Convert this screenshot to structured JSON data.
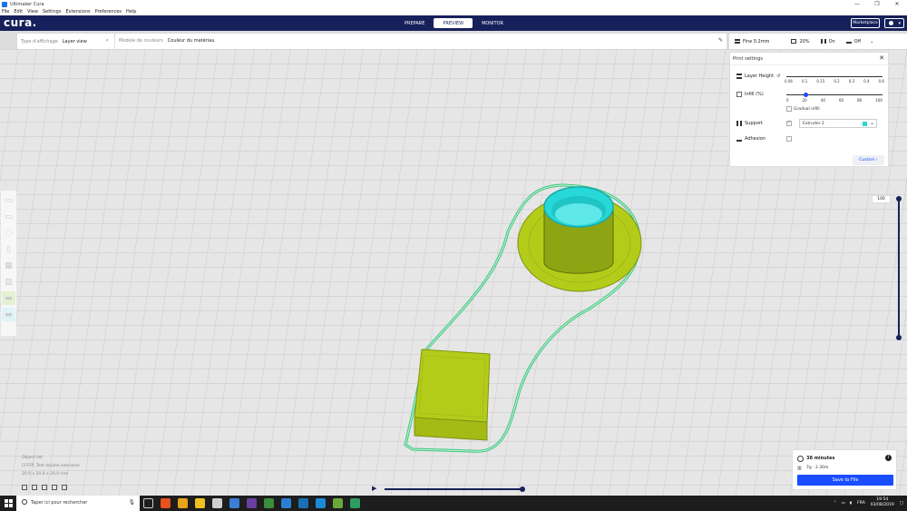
{
  "window": {
    "title": "Ultimaker Cura",
    "controls": [
      "—",
      "❐",
      "✕"
    ]
  },
  "menu": [
    "File",
    "Edit",
    "View",
    "Settings",
    "Extensions",
    "Preferences",
    "Help"
  ],
  "header": {
    "logo": "cura.",
    "stages": [
      "PREPARE",
      "PREVIEW",
      "MONITOR"
    ],
    "active_stage": "PREVIEW",
    "marketplace": "Marketplace"
  },
  "viewbar": {
    "view_type_label": "Type d'affichage",
    "view_type_value": "Layer view",
    "color_label": "Modèle de couleurs",
    "color_value": "Couleur du matériau"
  },
  "printbar": {
    "profile": "Fine 0.2mm",
    "infill": "20%",
    "support": "On",
    "adhesion": "Off"
  },
  "print_settings": {
    "title": "Print settings",
    "layer_height": {
      "label": "Layer Height",
      "ticks": [
        "0.06",
        "0.1",
        "0.15",
        "0.2",
        "0.3",
        "0.4",
        "0.6"
      ]
    },
    "infill": {
      "label": "Infill (%)",
      "ticks": [
        "0",
        "20",
        "40",
        "60",
        "80",
        "100"
      ],
      "value_fraction": 0.2,
      "gradual_label": "Gradual infill"
    },
    "support": {
      "label": "Support",
      "checked": true,
      "extruder": "Extruder 2",
      "extruder_color": "#27d8d8"
    },
    "adhesion": {
      "label": "Adhesion",
      "checked": false
    },
    "custom_button": "Custom"
  },
  "layer_slider": {
    "value": "100"
  },
  "object_info": {
    "list_label": "Object list",
    "name": "CFFFP_Test double extrusion",
    "dims": "20.0 x 20.0 x 20.0 mm"
  },
  "output": {
    "time": "38 minutes",
    "material": "7g · 2.30m",
    "save": "Save to File"
  },
  "taskbar": {
    "search_placeholder": "Taper ici pour rechercher",
    "lang": "FRA",
    "time": "19:54",
    "date": "03/08/2019"
  },
  "colors": {
    "header": "#16215b",
    "accent": "#1a4dff",
    "model_yellow": "#b3cc1a",
    "support_cyan": "#27d8d8",
    "skirt": "#3bc47c"
  }
}
